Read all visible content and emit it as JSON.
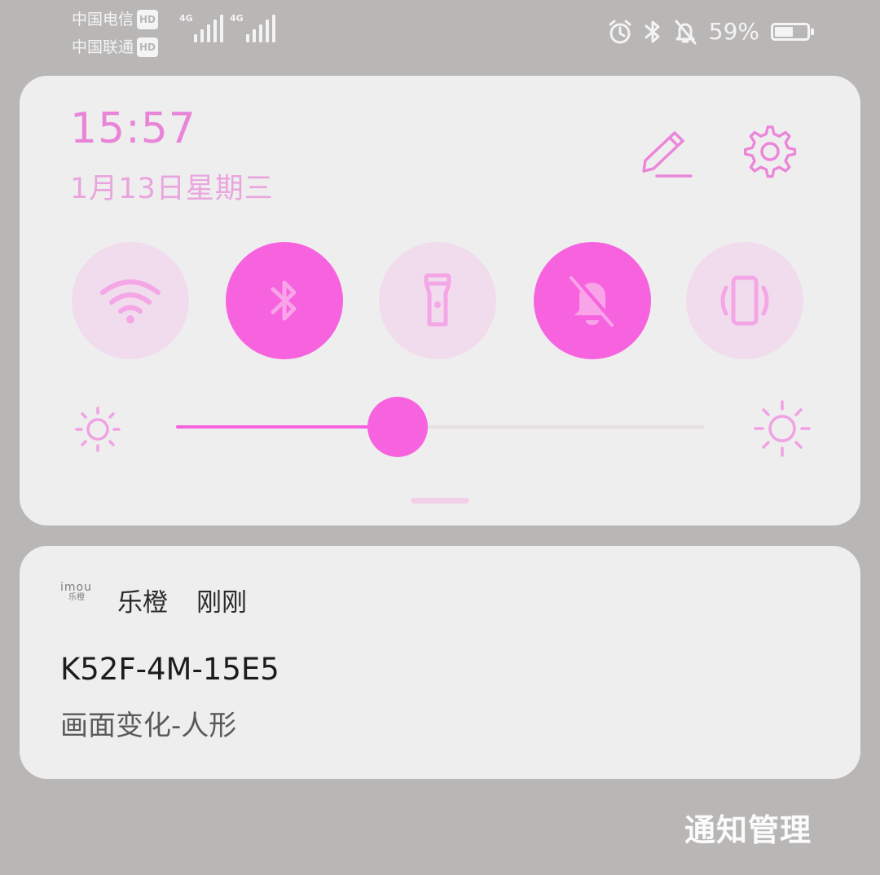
{
  "status_bar": {
    "carrier1": "中国电信",
    "carrier2": "中国联通",
    "hd_badge": "HD",
    "signal_label": "4G",
    "battery_percent": "59%",
    "battery_level": 0.59,
    "icons": [
      "alarm-icon",
      "bluetooth-icon",
      "bell-off-icon",
      "battery-icon"
    ]
  },
  "quick_settings": {
    "time": "15:57",
    "date": "1月13日星期三",
    "toggles": [
      {
        "name": "wifi",
        "icon": "wifi-icon",
        "active": false
      },
      {
        "name": "bluetooth",
        "icon": "bluetooth-icon",
        "active": true
      },
      {
        "name": "flashlight",
        "icon": "flashlight-icon",
        "active": false
      },
      {
        "name": "do-not-disturb",
        "icon": "bell-off-icon",
        "active": true
      },
      {
        "name": "vibrate",
        "icon": "vibrate-icon",
        "active": false
      }
    ],
    "brightness_level": 0.42,
    "accent_color": "#f763df"
  },
  "notification": {
    "app_logo": "imou",
    "app_logo_sub": "乐橙",
    "app_name": "乐橙",
    "time": "刚刚",
    "title": "K52F-4M-15E5",
    "body": "画面变化-人形"
  },
  "footer": {
    "manage_label": "通知管理"
  }
}
